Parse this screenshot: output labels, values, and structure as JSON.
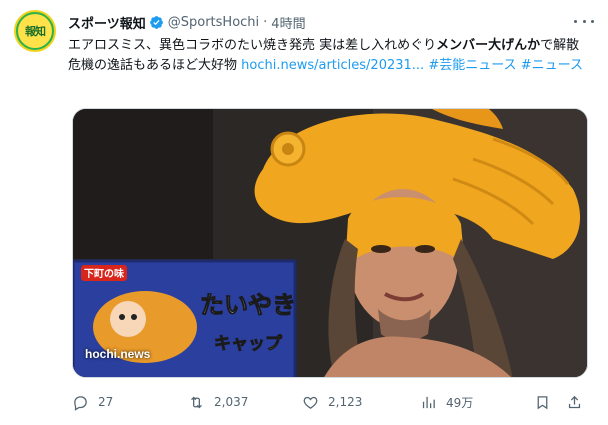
{
  "account": {
    "display_name": "スポーツ報知",
    "handle": "@SportsHochi",
    "separator": "·",
    "time": "4時間",
    "avatar_text": "報知",
    "verified_icon": "verified-badge-icon",
    "verified_color": "#1d9bf0"
  },
  "tweet": {
    "text_part1": "エアロスミス、異色コラボのたい焼き発売 実は差し入れめぐり",
    "text_bold": "メンバー大げんか",
    "text_part2": "で解散危機の逸話もあるほど大好物 ",
    "link": "hochi.news/articles/20231...",
    "hashtag1": "#芸能ニュース",
    "hashtag2": "#ニュース"
  },
  "media": {
    "watermark": "hochi.news",
    "sign_small": "下町の味",
    "sign_main": "たいやき",
    "sign_sub": "キャップ"
  },
  "actions": {
    "replies": "27",
    "reposts": "2,037",
    "likes": "2,123",
    "views": "49万",
    "icons": [
      "reply-icon",
      "repost-icon",
      "like-icon",
      "views-icon",
      "bookmark-icon",
      "share-icon"
    ]
  },
  "colors": {
    "text": "#0f1419",
    "secondary": "#536471",
    "link": "#1d9bf0"
  }
}
